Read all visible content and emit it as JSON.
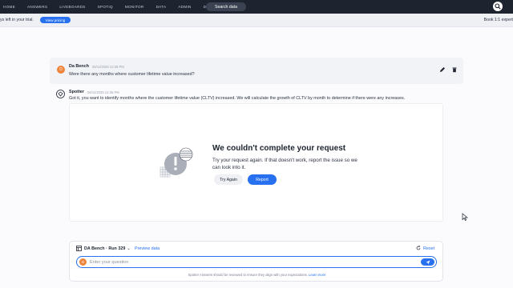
{
  "nav": {
    "items": [
      "HOME",
      "ANSWERS",
      "LIVEBOARDS",
      "SPOTIQ",
      "MONITOR",
      "DATA",
      "ADMIN",
      "DEVELOP"
    ],
    "search_label": "Search data"
  },
  "trial": {
    "text": "ys left in your trial.",
    "pricing_button": "View pricing",
    "book_text": "Book 1:1 expert"
  },
  "conversation": {
    "user": {
      "initial": "D",
      "name": "Da Bench",
      "time": "06/11/2025 12:36 PM",
      "question": "Were there any months where customer lifetime value increased?"
    },
    "spotter": {
      "name": "Spotter",
      "time": "06/11/2025 12:36 PM",
      "response": "Got it, you want to identify months where the customer lifetime value (CLTV) increased. We will calculate the growth of CLTV by month to determine if there were any increases."
    }
  },
  "error": {
    "title": "We couldn't complete your request",
    "description": "Try your request again. If that doesn't work, report the issue so we can look into it.",
    "try_again": "Try Again",
    "report": "Report"
  },
  "composer": {
    "datasource": "DA Bench · Run 329",
    "preview": "Preview data",
    "reset": "Reset",
    "avatar_initial": "D",
    "placeholder": "Enter your question",
    "disclaimer": "Spotter Answers should be reviewed to ensure they align with your expectations.",
    "learn_more": "Learn more"
  },
  "colors": {
    "nav_bg": "#1d232f",
    "accent": "#2770ef",
    "avatar": "#f0833a"
  },
  "icons": [
    "user-avatar-icon",
    "edit-icon",
    "delete-icon",
    "spotter-logo-icon",
    "error-illustration-icon",
    "datasource-icon",
    "reset-icon",
    "send-icon",
    "cursor-icon"
  ]
}
